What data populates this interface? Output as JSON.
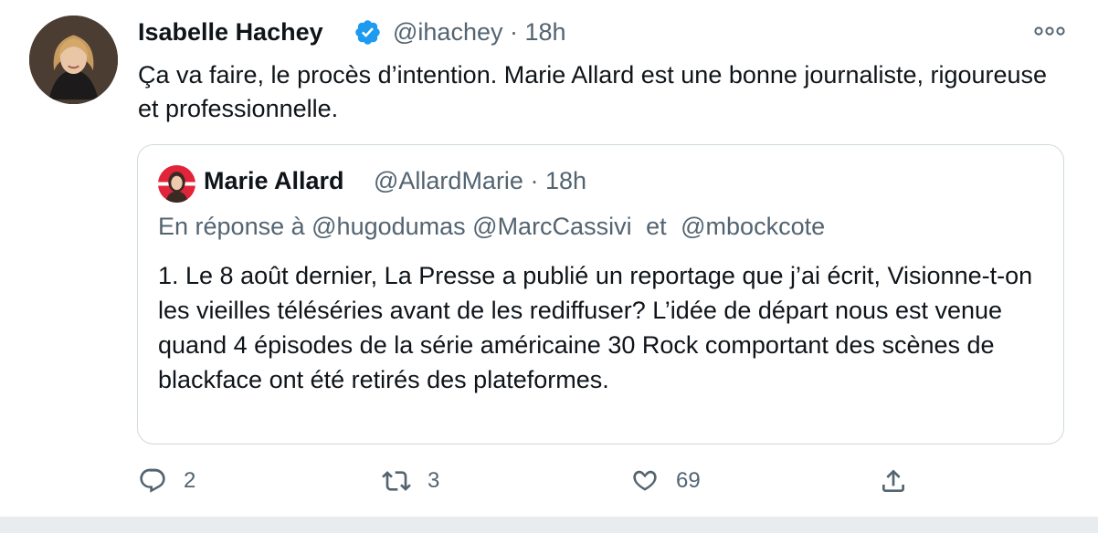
{
  "tweet": {
    "author_name": "Isabelle Hachey",
    "handle_time": "@ihachey · 18h",
    "text": "Ça va faire, le procès d’intention. Marie Allard est une bonne journaliste, rigoureuse et professionnelle.",
    "icons": {
      "avatar": "author-photo",
      "verified": "verified-badge-icon",
      "more": "more-options-icon"
    }
  },
  "quoted_tweet": {
    "author_name": "Marie Allard",
    "handle_time": "@AllardMarie · 18h",
    "reply_prefix": "En réponse à",
    "reply_mentions": "@hugodumas @MarcCassivi",
    "reply_and": "et",
    "reply_last_mention": "@mbockcote",
    "text": "1. Le 8 août dernier, La Presse a publié un reportage que j’ai écrit, Visionne-t-on les vieilles téléséries avant de les rediffuser? L’idée de départ nous est venue quand 4 épisodes de la série américaine 30 Rock comportant des scènes de blackface ont été retirés des plateformes."
  },
  "actions": {
    "reply_count": "2",
    "retweet_count": "3",
    "like_count": "69"
  },
  "colors": {
    "verified": "#1d9bf0",
    "secondary_text": "#536471",
    "border": "#cfd9de",
    "footer": "#e8ecef"
  }
}
